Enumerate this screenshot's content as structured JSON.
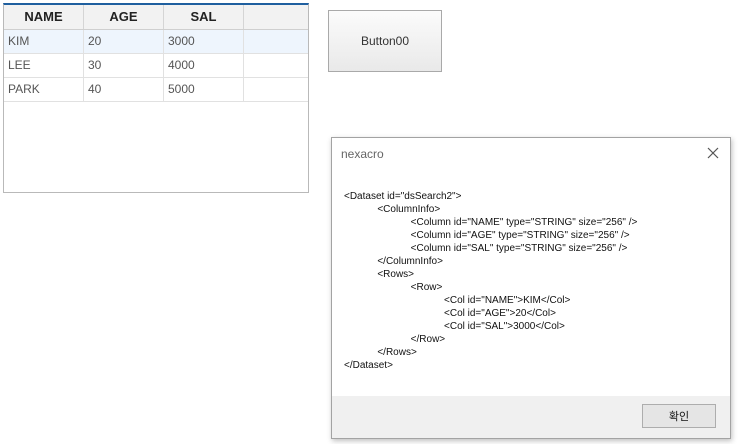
{
  "grid": {
    "columns": [
      "NAME",
      "AGE",
      "SAL"
    ],
    "rows": [
      {
        "name": "KIM",
        "age": "20",
        "sal": "3000"
      },
      {
        "name": "LEE",
        "age": "30",
        "sal": "4000"
      },
      {
        "name": "PARK",
        "age": "40",
        "sal": "5000"
      }
    ]
  },
  "button00": {
    "label": "Button00"
  },
  "dialog": {
    "title": "nexacro",
    "close_icon": "close-icon",
    "message": "<Dataset id=\"dsSearch2\">\n            <ColumnInfo>\n                        <Column id=\"NAME\" type=\"STRING\" size=\"256\" />\n                        <Column id=\"AGE\" type=\"STRING\" size=\"256\" />\n                        <Column id=\"SAL\" type=\"STRING\" size=\"256\" />\n            </ColumnInfo>\n            <Rows>\n                        <Row>\n                                    <Col id=\"NAME\">KIM</Col>\n                                    <Col id=\"AGE\">20</Col>\n                                    <Col id=\"SAL\">3000</Col>\n                        </Row>\n            </Rows>\n</Dataset>",
    "ok_label": "확인"
  }
}
